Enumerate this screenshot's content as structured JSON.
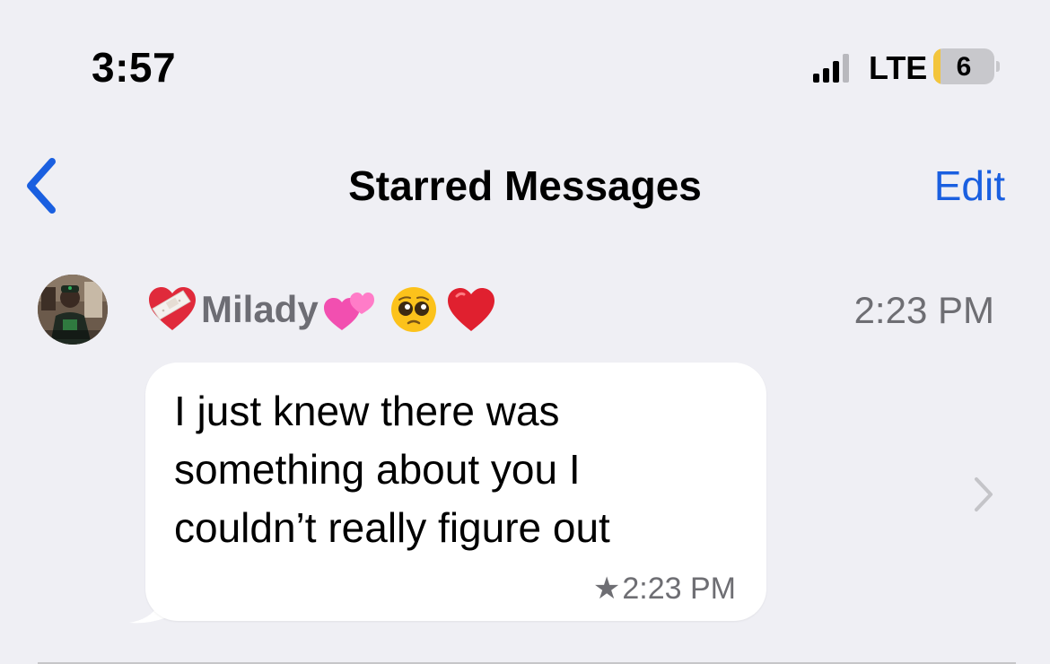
{
  "status_bar": {
    "time": "3:57",
    "network": "LTE",
    "battery_level": "6"
  },
  "nav": {
    "title": "Starred Messages",
    "edit_label": "Edit",
    "back_icon": "chevron-left-icon"
  },
  "message": {
    "sender_name": "Milady",
    "sender_emojis": [
      "heart-with-bandage",
      "two-hearts",
      "pleading-face",
      "red-heart"
    ],
    "time": "2:23 PM",
    "text": "I just knew there was\nsomething about you I\ncouldn’t really figure out",
    "starred_time": "2:23 PM"
  },
  "colors": {
    "background": "#efeff4",
    "accent": "#1a5fe0",
    "bubble": "#ffffff",
    "secondary_text": "#6e6e73"
  }
}
